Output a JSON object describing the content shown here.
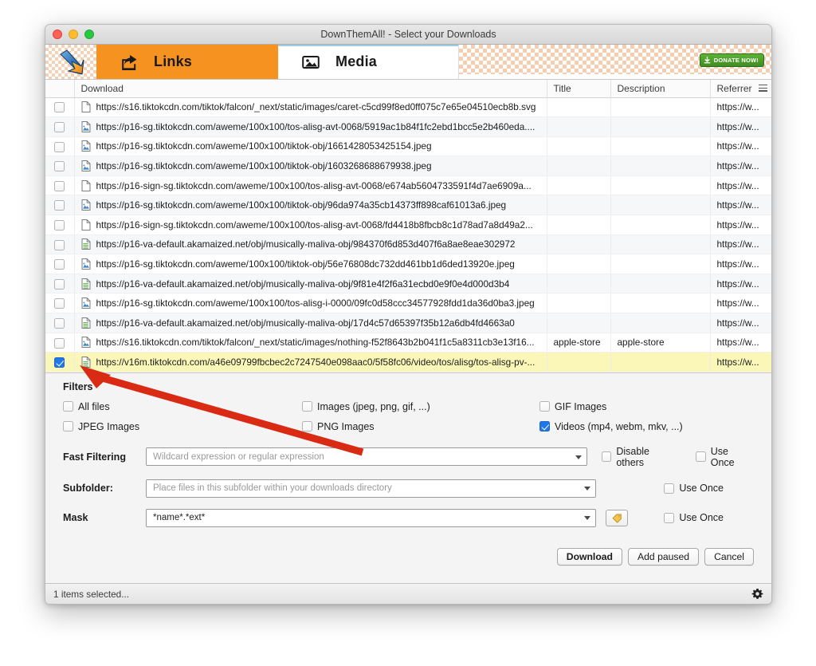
{
  "window": {
    "title": "DownThemAll! - Select your Downloads",
    "traffic_lights": [
      "close-red",
      "minimize-yellow",
      "zoom-green"
    ]
  },
  "tabs": [
    {
      "id": "links",
      "label": "Links",
      "icon": "share-link-icon",
      "active": true
    },
    {
      "id": "media",
      "label": "Media",
      "icon": "image-icon",
      "active": false
    }
  ],
  "promo": {
    "donate_label": "DONATE NOW!",
    "donate_icon": "download-arrow-icon"
  },
  "table": {
    "columns": [
      "Download",
      "Title",
      "Description",
      "Referrer"
    ],
    "menu_icon": "hamburger-menu-icon",
    "rows": [
      {
        "checked": false,
        "icon": "file-svg-icon",
        "url": "https://s16.tiktokcdn.com/tiktok/falcon/_next/static/images/caret-c5cd99f8ed0ff075c7e65e04510ecb8b.svg",
        "title": "",
        "description": "",
        "referrer": "https://w..."
      },
      {
        "checked": false,
        "icon": "image-file-icon",
        "url": "https://p16-sg.tiktokcdn.com/aweme/100x100/tos-alisg-avt-0068/5919ac1b84f1fc2ebd1bcc5e2b460eda....",
        "title": "",
        "description": "",
        "referrer": "https://w..."
      },
      {
        "checked": false,
        "icon": "image-file-icon",
        "url": "https://p16-sg.tiktokcdn.com/aweme/100x100/tiktok-obj/1661428053425154.jpeg",
        "title": "",
        "description": "",
        "referrer": "https://w..."
      },
      {
        "checked": false,
        "icon": "image-file-icon",
        "url": "https://p16-sg.tiktokcdn.com/aweme/100x100/tiktok-obj/1603268688679938.jpeg",
        "title": "",
        "description": "",
        "referrer": "https://w..."
      },
      {
        "checked": false,
        "icon": "file-blank-icon",
        "url": "https://p16-sign-sg.tiktokcdn.com/aweme/100x100/tos-alisg-avt-0068/e674ab5604733591f4d7ae6909a...",
        "title": "",
        "description": "",
        "referrer": "https://w..."
      },
      {
        "checked": false,
        "icon": "image-file-icon",
        "url": "https://p16-sg.tiktokcdn.com/aweme/100x100/tiktok-obj/96da974a35cb14373ff898caf61013a6.jpeg",
        "title": "",
        "description": "",
        "referrer": "https://w..."
      },
      {
        "checked": false,
        "icon": "file-blank-icon",
        "url": "https://p16-sign-sg.tiktokcdn.com/aweme/100x100/tos-alisg-avt-0068/fd4418b8fbcb8c1d78ad7a8d49a2...",
        "title": "",
        "description": "",
        "referrer": "https://w..."
      },
      {
        "checked": false,
        "icon": "video-file-icon",
        "url": "https://p16-va-default.akamaized.net/obj/musically-maliva-obj/984370f6d853d407f6a8ae8eae302972",
        "title": "",
        "description": "",
        "referrer": "https://w..."
      },
      {
        "checked": false,
        "icon": "image-file-icon",
        "url": "https://p16-sg.tiktokcdn.com/aweme/100x100/tiktok-obj/56e76808dc732dd461bb1d6ded13920e.jpeg",
        "title": "",
        "description": "",
        "referrer": "https://w..."
      },
      {
        "checked": false,
        "icon": "video-file-icon",
        "url": "https://p16-va-default.akamaized.net/obj/musically-maliva-obj/9f81e4f2f6a31ecbd0e9f0e4d000d3b4",
        "title": "",
        "description": "",
        "referrer": "https://w..."
      },
      {
        "checked": false,
        "icon": "image-file-icon",
        "url": "https://p16-sg.tiktokcdn.com/aweme/100x100/tos-alisg-i-0000/09fc0d58ccc34577928fdd1da36d0ba3.jpeg",
        "title": "",
        "description": "",
        "referrer": "https://w..."
      },
      {
        "checked": false,
        "icon": "video-file-icon",
        "url": "https://p16-va-default.akamaized.net/obj/musically-maliva-obj/17d4c57d65397f35b12a6db4fd4663a0",
        "title": "",
        "description": "",
        "referrer": "https://w..."
      },
      {
        "checked": false,
        "icon": "image-file-icon",
        "url": "https://s16.tiktokcdn.com/tiktok/falcon/_next/static/images/nothing-f52f8643b2b041f1c5a8311cb3e13f16...",
        "title": "apple-store",
        "description": "apple-store",
        "referrer": "https://w..."
      },
      {
        "checked": true,
        "icon": "video-file-icon",
        "url": "https://v16m.tiktokcdn.com/a46e09799fbcbec2c7247540e098aac0/5f58fc06/video/tos/alisg/tos-alisg-pv-...",
        "title": "",
        "description": "",
        "referrer": "https://w..."
      }
    ]
  },
  "filters": {
    "heading": "Filters",
    "checkboxes": [
      {
        "label": "All files",
        "checked": false
      },
      {
        "label": "Images (jpeg, png, gif, ...)",
        "checked": false
      },
      {
        "label": "GIF Images",
        "checked": false
      },
      {
        "label": "JPEG Images",
        "checked": false
      },
      {
        "label": "PNG Images",
        "checked": false
      },
      {
        "label": "Videos (mp4, webm, mkv, ...)",
        "checked": true
      }
    ],
    "fast_filtering": {
      "label": "Fast Filtering",
      "value": "",
      "placeholder": "Wildcard expression or regular expression",
      "disable_others_label": "Disable others",
      "disable_others_checked": false,
      "use_once_label": "Use Once",
      "use_once_checked": false
    },
    "subfolder": {
      "label": "Subfolder:",
      "value": "",
      "placeholder": "Place files in this subfolder within your downloads directory",
      "use_once_label": "Use Once",
      "use_once_checked": false
    },
    "mask": {
      "label": "Mask",
      "value": "*name*.*ext*",
      "placeholder": "",
      "tag_icon": "tag-icon",
      "use_once_label": "Use Once",
      "use_once_checked": false
    }
  },
  "actions": [
    {
      "id": "download",
      "label": "Download",
      "primary": true
    },
    {
      "id": "add-paused",
      "label": "Add paused",
      "primary": false
    },
    {
      "id": "cancel",
      "label": "Cancel",
      "primary": false
    }
  ],
  "status": {
    "text": "1 items selected...",
    "gear_icon": "gear-icon"
  },
  "annotation": {
    "type": "red-arrow",
    "color": "#d92b14"
  },
  "colors": {
    "accent_orange": "#f59220",
    "selected_row": "#fbf7b8",
    "checkbox_blue": "#2176e8",
    "donate_green": "#3f8c22",
    "annotation_red": "#d92b14"
  }
}
